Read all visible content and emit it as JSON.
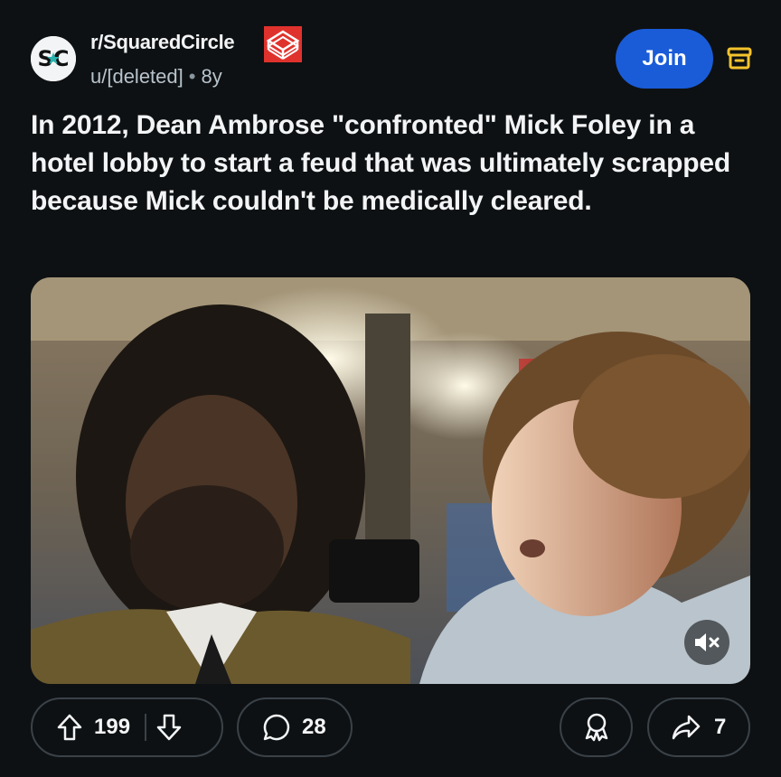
{
  "header": {
    "subreddit": "r/SquaredCircle",
    "avatar_text": "SC",
    "author": "u/[deleted]",
    "separator": "•",
    "age": "8y",
    "join_label": "Join"
  },
  "post": {
    "title": "In 2012, Dean Ambrose \"confronted\" Mick Foley in a hotel lobby to start a feud that was ultimately scrapped because Mick couldn't be medically cleared."
  },
  "actions": {
    "upvotes": "199",
    "comments": "28",
    "shares": "7"
  },
  "icons": {
    "vote_up": "upvote-arrow-icon",
    "vote_down": "downvote-arrow-icon",
    "comment": "comment-bubble-icon",
    "award": "award-icon",
    "share": "share-arrow-icon",
    "mute": "speaker-muted-icon",
    "archive": "archive-box-icon"
  },
  "colors": {
    "background": "#0e1113",
    "join_button": "#1a5cd8",
    "archive_icon": "#f5c32c",
    "flair_red": "#e0322d"
  }
}
